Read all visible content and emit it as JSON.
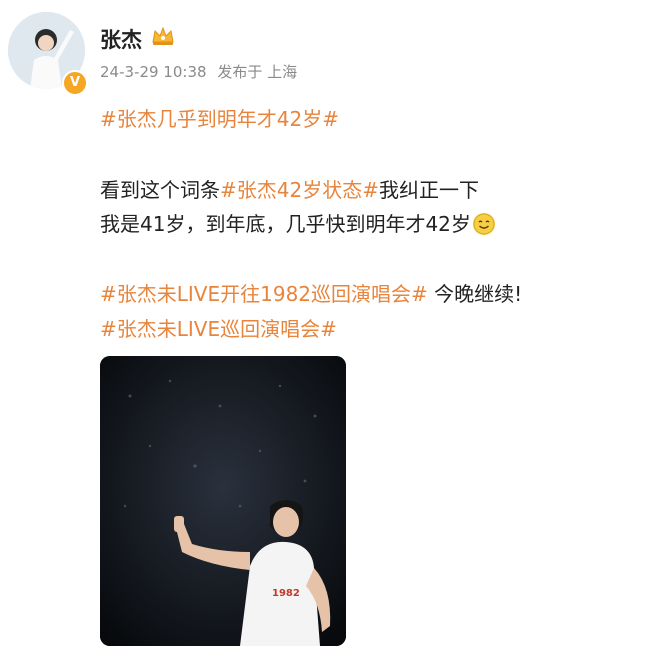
{
  "user": {
    "name": "张杰",
    "date": "24-3-29 10:38",
    "posted_from": "发布于 上海"
  },
  "post": {
    "line1_tag": "#张杰几乎到明年才42岁#",
    "line2_before": "看到这个词条",
    "line2_tag": "#张杰42岁状态#",
    "line2_after": "我纠正一下",
    "line3_text": "我是41岁，到年底，几乎快到明年才42岁",
    "line4_tag": "#张杰未LIVE开往1982巡回演唱会#",
    "line4_after": " 今晚继续!",
    "line5_tag": "#张杰未LIVE巡回演唱会#"
  },
  "colors": {
    "tag": "#e8843b",
    "verified": "#f5a623"
  },
  "icons": {
    "verified": "verified-v-icon",
    "crown": "crown-badge-icon",
    "emoji": "smile-emoji-icon"
  }
}
